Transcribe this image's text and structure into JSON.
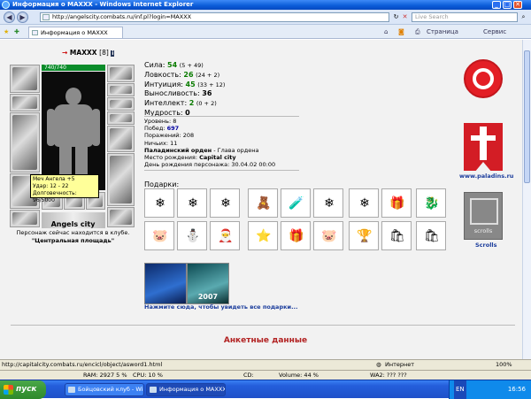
{
  "window": {
    "title": "Информация о MAXXX - Windows Internet Explorer",
    "min": "_",
    "max": "□",
    "close": "✕"
  },
  "address": {
    "url": "http://angelscity.combats.ru/inf.pl?login=MAXXX",
    "search_placeholder": "Live Search"
  },
  "tab": {
    "label": "Информация о MAXXX"
  },
  "toolbar": {
    "page": "Страница",
    "service": "Сервис"
  },
  "character": {
    "name": "MAXXX",
    "level": "[8]",
    "hp": "740/740",
    "city": "Angels city",
    "status_line1": "Персонаж сейчас находится в клубе.",
    "status_line2": "\"Центральная площадь\""
  },
  "tooltip": {
    "line1": "Меч Ангела +5",
    "line2": "Удар: 12 - 22",
    "line3": "Долговечность: 96/5000"
  },
  "stats": [
    {
      "label": "Сила:",
      "value": "54",
      "extra": "(5 + 49)"
    },
    {
      "label": "Ловкость:",
      "value": "26",
      "extra": "(24 + 2)"
    },
    {
      "label": "Интуиция:",
      "value": "45",
      "extra": "(33 + 12)"
    },
    {
      "label": "Выносливость:",
      "value": "36",
      "extra": ""
    },
    {
      "label": "Интеллект:",
      "value": "2",
      "extra": "(0 + 2)"
    },
    {
      "label": "Мудрость:",
      "value": "0",
      "extra": ""
    }
  ],
  "info": {
    "level": "Уровень: 8",
    "wins_label": "Побед:",
    "wins": "697",
    "losses": "Поражений: 208",
    "draws": "Ничьих: 11",
    "order_label": "Паладинский орден",
    "order_rank": "- Глава ордена",
    "birthplace_label": "Место рождения:",
    "birthplace": "Capital city",
    "birthday": "День рождения персонажа: 30.04.02 00:00"
  },
  "gifts": {
    "label": "Подарки:",
    "row1": [
      "❄",
      "❄",
      "❄",
      "🧸",
      "🧪",
      "❄",
      "❄",
      "🎁",
      "🐉"
    ],
    "row2": [
      "🐷",
      "⛄",
      "🎅",
      "⭐",
      "🎁",
      "🐷",
      "🏆",
      "🛍",
      "🛍"
    ],
    "big": [
      "",
      "2007"
    ],
    "see_all": "Нажмите сюда, чтобы увидеть все подарки..."
  },
  "section_title": "Анкетные данные",
  "right": {
    "paladins": "www.paladins.ru",
    "scrolls_label": "scrolls",
    "scrolls_link": "Scrolls"
  },
  "statusbar": {
    "url": "http://capitalcity.combats.ru/encicl/object/asword1.html",
    "zone": "Интернет",
    "zoom": "100%"
  },
  "perfbar": {
    "ram": "RAM:  2927 5 %",
    "cpu": "CPU:  10 %",
    "cd": "CD:",
    "volume": "Volume:  44 %",
    "wa": "WA2:  ??? ???"
  },
  "taskbar": {
    "start": "пуск",
    "btn1": "Бойцовский клуб - Win...",
    "btn2": "Информация о MAXXX ...",
    "lang": "EN",
    "clock": "16:56"
  }
}
